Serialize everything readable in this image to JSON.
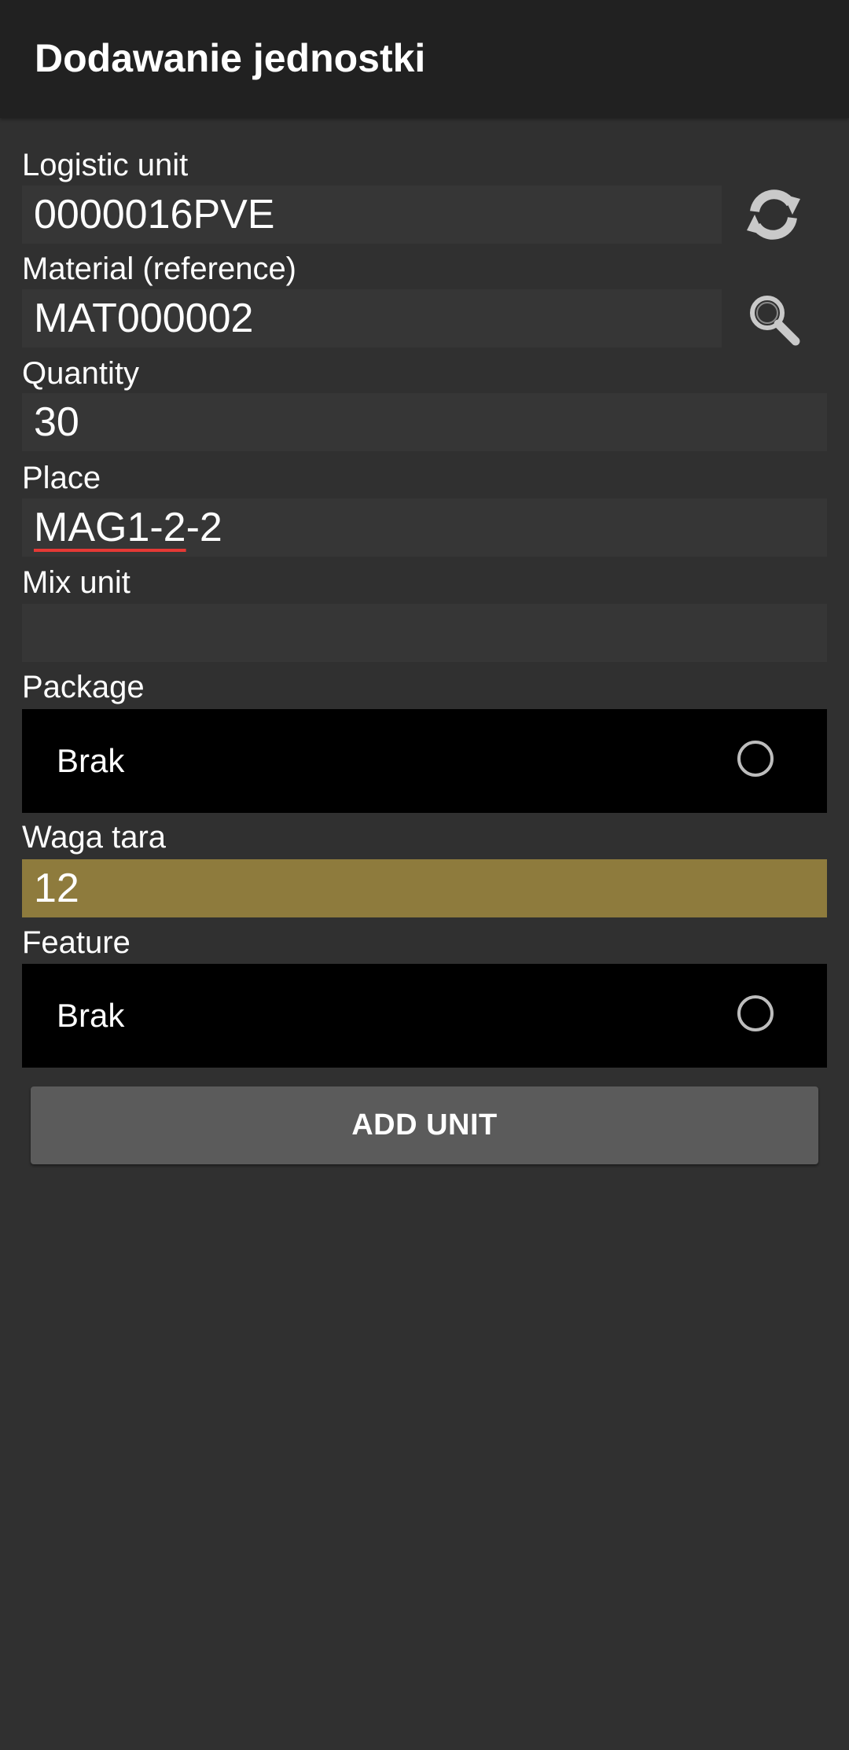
{
  "header": {
    "title": "Dodawanie jednostki"
  },
  "form": {
    "logistic_unit": {
      "label": "Logistic unit",
      "value": "0000016PVE",
      "action_icon": "refresh-icon"
    },
    "material": {
      "label": "Material (reference)",
      "value": "MAT000002",
      "action_icon": "search-icon"
    },
    "quantity": {
      "label": "Quantity",
      "value": "30"
    },
    "place": {
      "label": "Place",
      "value_underlined": "MAG1-2",
      "value_rest": "-2"
    },
    "mix_unit": {
      "label": "Mix unit",
      "value": ""
    },
    "package": {
      "label": "Package",
      "selected": "Brak"
    },
    "waga_tara": {
      "label": "Waga tara",
      "value": "12"
    },
    "feature": {
      "label": "Feature",
      "selected": "Brak"
    },
    "submit_label": "ADD UNIT"
  },
  "colors": {
    "background": "#303030",
    "app_bar": "#212121",
    "input_bg": "#363636",
    "highlight_input": "#8e7b3d",
    "select_bg": "#000000",
    "button_bg": "#5b5b5b",
    "spellcheck_underline": "#e53935"
  }
}
